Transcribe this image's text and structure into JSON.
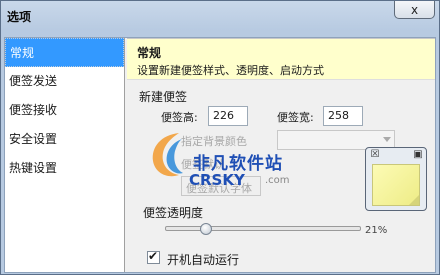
{
  "window": {
    "title": "选项",
    "close_label": "x"
  },
  "sidebar": {
    "items": [
      {
        "label": "常规",
        "active": true
      },
      {
        "label": "便签发送",
        "active": false
      },
      {
        "label": "便签接收",
        "active": false
      },
      {
        "label": "安全设置",
        "active": false
      },
      {
        "label": "热键设置",
        "active": false
      }
    ]
  },
  "header": {
    "title": "常规",
    "description": "设置新建便签样式、透明度、启动方式"
  },
  "new_note": {
    "group_label": "新建便签",
    "height_label": "便签高:",
    "height_value": "226",
    "width_label": "便签宽:",
    "width_value": "258",
    "bg_color_label": "指定背景颜色",
    "default_color_label": "便签默认",
    "default_font_label": "便签默认字体"
  },
  "transparency": {
    "label": "便签透明度",
    "value_text": "21%",
    "value": 0.21
  },
  "startup": {
    "label": "开机自动运行",
    "checked": true
  },
  "watermark": {
    "cn_text": "非凡软件站",
    "en_text": "CRSKY",
    "com_text": ".com"
  },
  "icons": {
    "close": "close-icon",
    "note_close": "note-close-icon",
    "note_window": "note-window-icon"
  }
}
